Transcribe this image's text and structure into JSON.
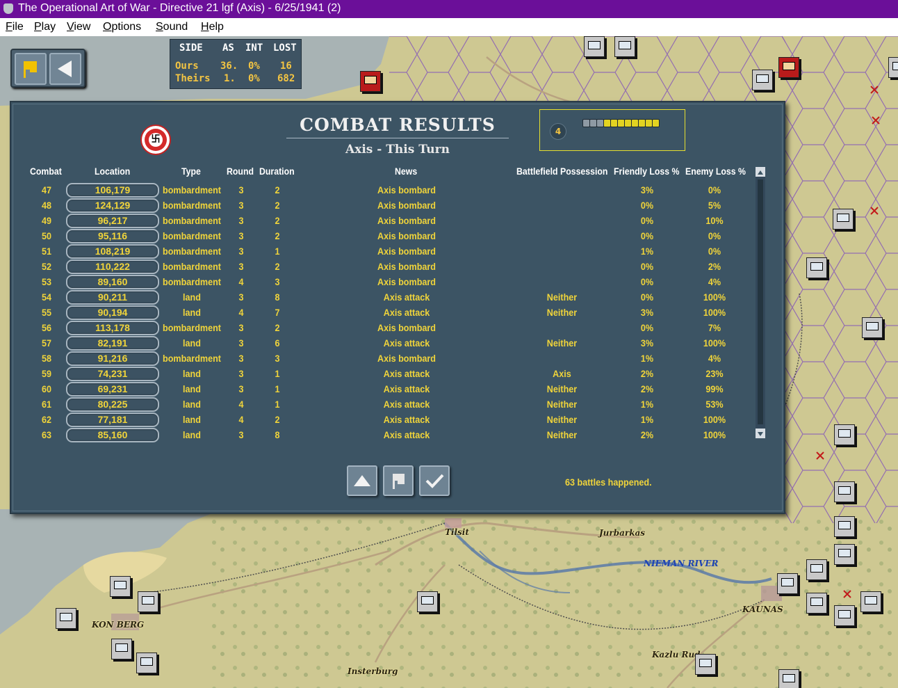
{
  "window": {
    "title": "The Operational Art of War - Directive 21 lgf (Axis) - 6/25/1941 (2)"
  },
  "menu": [
    {
      "accel": "F",
      "rest": "ile"
    },
    {
      "accel": "P",
      "rest": "lay"
    },
    {
      "accel": "V",
      "rest": "iew"
    },
    {
      "accel": "O",
      "rest": "ptions"
    },
    {
      "accel": "S",
      "rest": "ound"
    },
    {
      "accel": "H",
      "rest": "elp"
    }
  ],
  "score": {
    "headers": [
      "SIDE",
      "AS",
      "INT",
      "LOST"
    ],
    "ours": {
      "label": "Ours",
      "as": "36.",
      "int": "0%",
      "lost": "16"
    },
    "theirs": {
      "label": "Theirs",
      "as": "1.",
      "int": "0%",
      "lost": "682"
    }
  },
  "dialog": {
    "title": "COMBAT RESULTS",
    "subtitle": "Axis - This Turn",
    "round_number": "4",
    "round_pips_total": 11,
    "round_pips_filled": 8,
    "columns": {
      "combat": "Combat",
      "location": "Location",
      "type": "Type",
      "round": "Round",
      "duration": "Duration",
      "news": "News",
      "possession": "Battlefield Possession",
      "friendly": "Friendly Loss %",
      "enemy": "Enemy Loss %"
    },
    "rows": [
      {
        "num": "47",
        "loc": "106,179",
        "type": "bombardment",
        "round": "3",
        "dur": "2",
        "news": "Axis bombard",
        "poss": "",
        "fl": "3%",
        "el": "0%"
      },
      {
        "num": "48",
        "loc": "124,129",
        "type": "bombardment",
        "round": "3",
        "dur": "2",
        "news": "Axis bombard",
        "poss": "",
        "fl": "0%",
        "el": "5%"
      },
      {
        "num": "49",
        "loc": "96,217",
        "type": "bombardment",
        "round": "3",
        "dur": "2",
        "news": "Axis bombard",
        "poss": "",
        "fl": "0%",
        "el": "10%"
      },
      {
        "num": "50",
        "loc": "95,116",
        "type": "bombardment",
        "round": "3",
        "dur": "2",
        "news": "Axis bombard",
        "poss": "",
        "fl": "0%",
        "el": "0%"
      },
      {
        "num": "51",
        "loc": "108,219",
        "type": "bombardment",
        "round": "3",
        "dur": "1",
        "news": "Axis bombard",
        "poss": "",
        "fl": "1%",
        "el": "0%"
      },
      {
        "num": "52",
        "loc": "110,222",
        "type": "bombardment",
        "round": "3",
        "dur": "2",
        "news": "Axis bombard",
        "poss": "",
        "fl": "0%",
        "el": "2%"
      },
      {
        "num": "53",
        "loc": "89,160",
        "type": "bombardment",
        "round": "4",
        "dur": "3",
        "news": "Axis bombard",
        "poss": "",
        "fl": "0%",
        "el": "4%"
      },
      {
        "num": "54",
        "loc": "90,211",
        "type": "land",
        "round": "3",
        "dur": "8",
        "news": "Axis attack",
        "poss": "Neither",
        "fl": "0%",
        "el": "100%"
      },
      {
        "num": "55",
        "loc": "90,194",
        "type": "land",
        "round": "4",
        "dur": "7",
        "news": "Axis attack",
        "poss": "Neither",
        "fl": "3%",
        "el": "100%"
      },
      {
        "num": "56",
        "loc": "113,178",
        "type": "bombardment",
        "round": "3",
        "dur": "2",
        "news": "Axis bombard",
        "poss": "",
        "fl": "0%",
        "el": "7%"
      },
      {
        "num": "57",
        "loc": "82,191",
        "type": "land",
        "round": "3",
        "dur": "6",
        "news": "Axis attack",
        "poss": "Neither",
        "fl": "3%",
        "el": "100%"
      },
      {
        "num": "58",
        "loc": "91,216",
        "type": "bombardment",
        "round": "3",
        "dur": "3",
        "news": "Axis bombard",
        "poss": "",
        "fl": "1%",
        "el": "4%"
      },
      {
        "num": "59",
        "loc": "74,231",
        "type": "land",
        "round": "3",
        "dur": "1",
        "news": "Axis attack",
        "poss": "Axis",
        "fl": "2%",
        "el": "23%"
      },
      {
        "num": "60",
        "loc": "69,231",
        "type": "land",
        "round": "3",
        "dur": "1",
        "news": "Axis attack",
        "poss": "Neither",
        "fl": "2%",
        "el": "99%"
      },
      {
        "num": "61",
        "loc": "80,225",
        "type": "land",
        "round": "4",
        "dur": "1",
        "news": "Axis attack",
        "poss": "Neither",
        "fl": "1%",
        "el": "53%"
      },
      {
        "num": "62",
        "loc": "77,181",
        "type": "land",
        "round": "4",
        "dur": "2",
        "news": "Axis attack",
        "poss": "Neither",
        "fl": "1%",
        "el": "100%"
      },
      {
        "num": "63",
        "loc": "85,160",
        "type": "land",
        "round": "3",
        "dur": "8",
        "news": "Axis attack",
        "poss": "Neither",
        "fl": "2%",
        "el": "100%"
      }
    ],
    "status": "63 battles happened."
  },
  "map_labels": [
    {
      "key": "tilsit",
      "text": "Tilsit"
    },
    {
      "key": "jurbarkas",
      "text": "Jurbarkas"
    },
    {
      "key": "kaunas",
      "text": "KAUNAS"
    },
    {
      "key": "insterburg",
      "text": "Insterburg"
    },
    {
      "key": "kazlu",
      "text": "Kazlu Rud"
    },
    {
      "key": "konigsberg",
      "text": "KON   BERG"
    }
  ],
  "river_label": "NIEMAN RIVER",
  "colors": {
    "titlebar": "#6b0f99",
    "dialog_bg": "#3c5464",
    "text_yellow": "#f0d43a",
    "sea": "#a8b3b4",
    "land": "#cec892"
  },
  "icons": [
    "flag-icon",
    "back-arrow-icon",
    "scroll-up-icon",
    "checkmark-icon",
    "nazi-emblem-icon"
  ]
}
